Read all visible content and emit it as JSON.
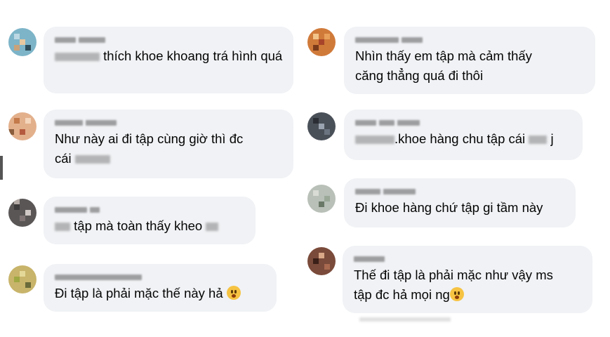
{
  "comments": [
    {
      "id": "c1",
      "text": "thích khoe khoang trá hình quá",
      "text_line2": ""
    },
    {
      "id": "c2",
      "text": "Như này ai đi tập cùng giờ thì đc",
      "text_line2": "cái"
    },
    {
      "id": "c3",
      "text": "tập mà toàn thấy kheo"
    },
    {
      "id": "c4",
      "text": "Đi tập là phải mặc thế này hả",
      "emoji": "flushed-face-icon"
    },
    {
      "id": "c5",
      "text": "Nhìn thấy em tập mà cảm thấy",
      "text_line2": "căng thẳng quá đi thôi"
    },
    {
      "id": "c6",
      "text": ".khoe hàng chu tập cái",
      "text_tail": "j"
    },
    {
      "id": "c7",
      "text": "Đi khoe hàng chứ tập gi tầm này"
    },
    {
      "id": "c8",
      "text": "Thế đi tập là phải mặc như vậy ms",
      "text_line2": "tập đc hả mọi ng",
      "emoji": "hushed-face-icon"
    }
  ],
  "colors": {
    "bubble": "#f0f2f5",
    "text": "#050505"
  }
}
